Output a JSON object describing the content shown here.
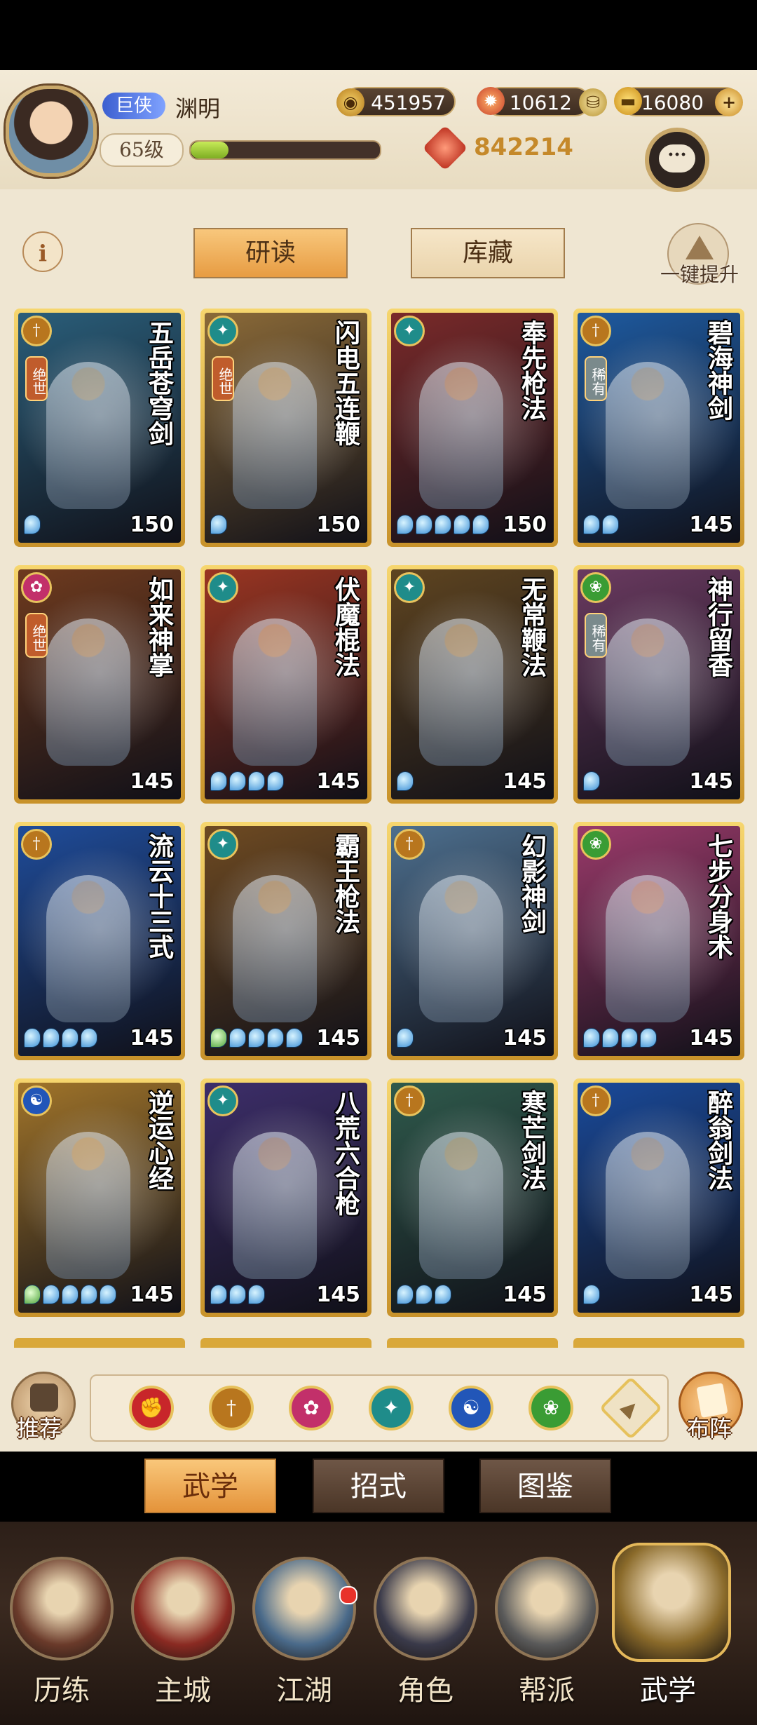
{
  "player": {
    "rank_badge": "巨侠",
    "name": "渊明",
    "level": "65级",
    "xp_progress": 0.2
  },
  "resources": {
    "coins": "451957",
    "ingots": "10612",
    "gold": "16080",
    "power": "842214"
  },
  "top_tabs": {
    "study": "研读",
    "storage": "库藏"
  },
  "upgrade_label": "一键提升",
  "cards": [
    {
      "title": "五岳苍穹剑",
      "tag": "绝世",
      "level": "150",
      "gems": 1,
      "green": 0,
      "school": "sword",
      "theme": "#2a5e7a"
    },
    {
      "title": "闪电五连鞭",
      "tag": "绝世",
      "level": "150",
      "gems": 1,
      "green": 0,
      "school": "teal",
      "theme": "#8b6a38"
    },
    {
      "title": "奉先枪法",
      "tag": "",
      "level": "150",
      "gems": 5,
      "green": 0,
      "school": "teal",
      "theme": "#7a2a2a"
    },
    {
      "title": "碧海神剑",
      "tag": "稀有",
      "level": "145",
      "gems": 2,
      "green": 0,
      "school": "sword",
      "theme": "#1e5aa0"
    },
    {
      "title": "如来神掌",
      "tag": "绝世",
      "level": "145",
      "gems": 0,
      "green": 0,
      "school": "pink",
      "theme": "#6e3a1e"
    },
    {
      "title": "伏魔棍法",
      "tag": "",
      "level": "145",
      "gems": 4,
      "green": 0,
      "school": "teal",
      "theme": "#9a3522"
    },
    {
      "title": "无常鞭法",
      "tag": "",
      "level": "145",
      "gems": 1,
      "green": 0,
      "school": "teal",
      "theme": "#5e4420"
    },
    {
      "title": "神行留香",
      "tag": "稀有",
      "level": "145",
      "gems": 1,
      "green": 0,
      "school": "green",
      "theme": "#6a3a60"
    },
    {
      "title": "流云十三式",
      "tag": "",
      "level": "145",
      "gems": 4,
      "green": 0,
      "school": "sword",
      "theme": "#1f4c9a"
    },
    {
      "title": "霸王枪法",
      "tag": "",
      "level": "145",
      "gems": 4,
      "green": 1,
      "school": "teal",
      "theme": "#6e4a22"
    },
    {
      "title": "幻影神剑",
      "tag": "",
      "level": "145",
      "gems": 1,
      "green": 0,
      "school": "sword",
      "theme": "#4d6f8e"
    },
    {
      "title": "七步分身术",
      "tag": "",
      "level": "145",
      "gems": 4,
      "green": 0,
      "school": "green",
      "theme": "#9a3a6a"
    },
    {
      "title": "逆运心经",
      "tag": "",
      "level": "145",
      "gems": 4,
      "green": 1,
      "school": "blue",
      "theme": "#a0742a"
    },
    {
      "title": "八荒六合枪",
      "tag": "",
      "level": "145",
      "gems": 3,
      "green": 0,
      "school": "teal",
      "theme": "#3d2e6a"
    },
    {
      "title": "寒芒剑法",
      "tag": "",
      "level": "145",
      "gems": 3,
      "green": 0,
      "school": "sword",
      "theme": "#2f5a4c"
    },
    {
      "title": "醉翁剑法",
      "tag": "",
      "level": "145",
      "gems": 1,
      "green": 0,
      "school": "sword",
      "theme": "#1a4a9a"
    }
  ],
  "side_buttons": {
    "recommend": "推荐",
    "formation": "布阵"
  },
  "filter_icons": [
    "red-fist",
    "sword",
    "pink-palm",
    "teal-fan",
    "blue-yinyang",
    "green-swirl",
    "all-up"
  ],
  "sub_tabs": {
    "martial": "武学",
    "moves": "招式",
    "atlas": "图鉴"
  },
  "nav": [
    {
      "label": "历练"
    },
    {
      "label": "主城"
    },
    {
      "label": "江湖"
    },
    {
      "label": "角色"
    },
    {
      "label": "帮派"
    },
    {
      "label": "武学"
    }
  ],
  "colors": {
    "accent_orange": "#e79c42",
    "card_gold": "#d9a83a",
    "bg_parchment": "#efe6d2"
  }
}
